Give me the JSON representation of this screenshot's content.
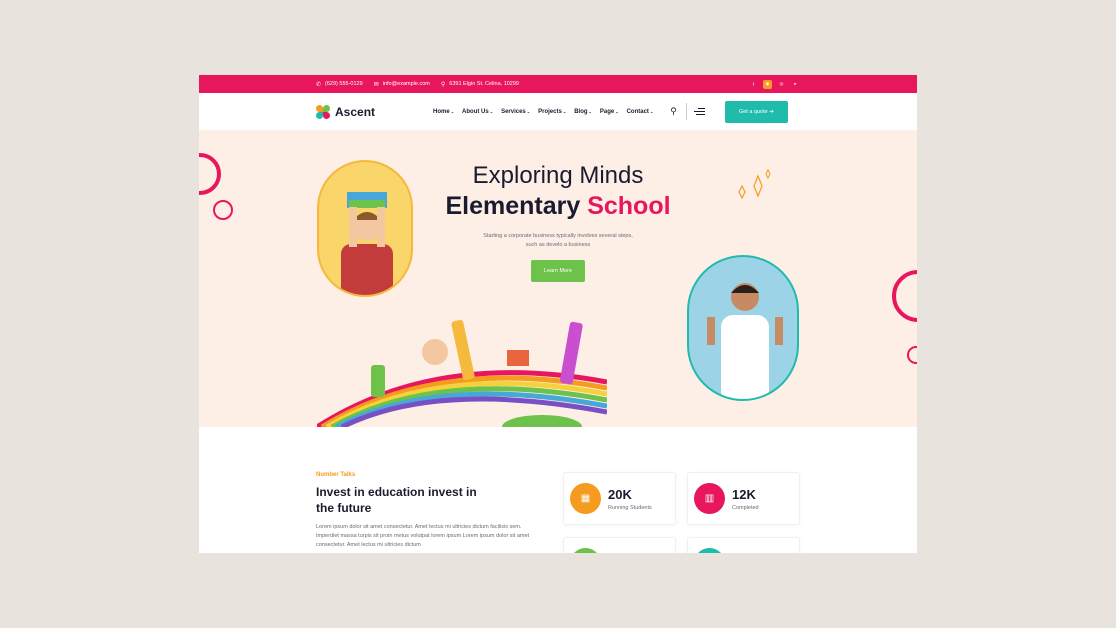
{
  "topbar": {
    "phone": "(629) 555-0129",
    "email": "info@example.com",
    "address": "6391 Elgin St. Celina, 10299",
    "socials": [
      "facebook-icon",
      "rss-icon",
      "instagram-icon",
      "youtube-icon"
    ]
  },
  "nav": {
    "logo": "Ascent",
    "menu": [
      "Home",
      "About Us",
      "Services",
      "Projects",
      "Blog",
      "Page",
      "Contact"
    ],
    "cta": "Get a quote"
  },
  "hero": {
    "tagline": "Exploring Minds",
    "title_main": "Elementary",
    "title_accent": "School",
    "description": "Starting a corporate business typically involves several steps, such as develo a business",
    "button": "Learn More"
  },
  "stats": {
    "label": "Number Talks",
    "title": "Invest in education invest in the future",
    "description": "Lorem ipsum dolor sit amet consectetur. Amet lectus mi ultricies dictum facilisis sem. Imperdiet massa turpis sit proin metus volutpat lorem ipsum Lorem ipsum dolor sit amet consectetur. Amet lectus mi ultricies dictum",
    "cards": [
      {
        "value": "20K",
        "label": "Running Students",
        "color": "#f59b1f",
        "icon": "classroom-icon"
      },
      {
        "value": "12K",
        "label": "Completed",
        "color": "#e8175d",
        "icon": "book-icon"
      }
    ]
  },
  "colors": {
    "primary": "#e8175d",
    "accent": "#1fbcae",
    "green": "#6cc24a",
    "orange": "#f59b1f"
  }
}
